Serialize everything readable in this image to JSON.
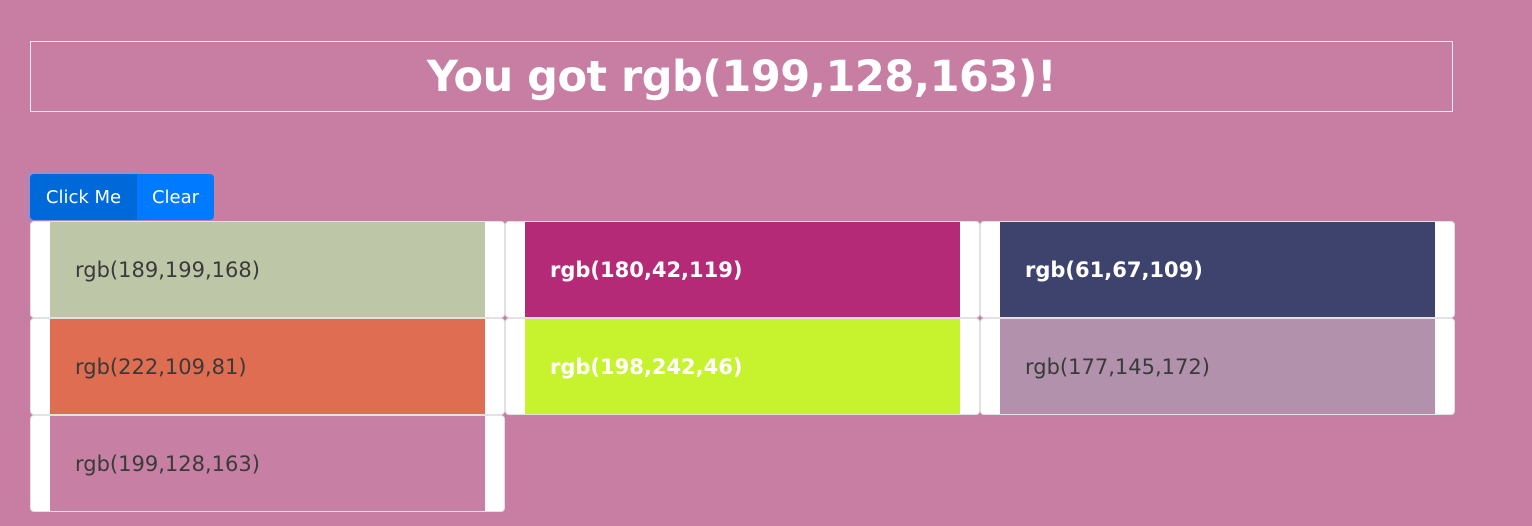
{
  "page": {
    "background": "#c77ea2",
    "title": "You got rgb(199,128,163)!"
  },
  "buttons": {
    "click_label": "Click Me",
    "clear_label": "Clear",
    "click_color": "#0069d9",
    "clear_color": "#007bff"
  },
  "swatches": [
    {
      "label": "rgb(189,199,168)",
      "color": "#bdc7a8",
      "text_style": "dark"
    },
    {
      "label": "rgb(180,42,119)",
      "color": "#b42a77",
      "text_style": "light"
    },
    {
      "label": "rgb(61,67,109)",
      "color": "#3d436d",
      "text_style": "light"
    },
    {
      "label": "rgb(222,109,81)",
      "color": "#de6d51",
      "text_style": "dark"
    },
    {
      "label": "rgb(198,242,46)",
      "color": "#c6f22e",
      "text_style": "light"
    },
    {
      "label": "rgb(177,145,172)",
      "color": "#b191ac",
      "text_style": "dark"
    },
    {
      "label": "rgb(199,128,163)",
      "color": "#c780a3",
      "text_style": "dark"
    }
  ]
}
